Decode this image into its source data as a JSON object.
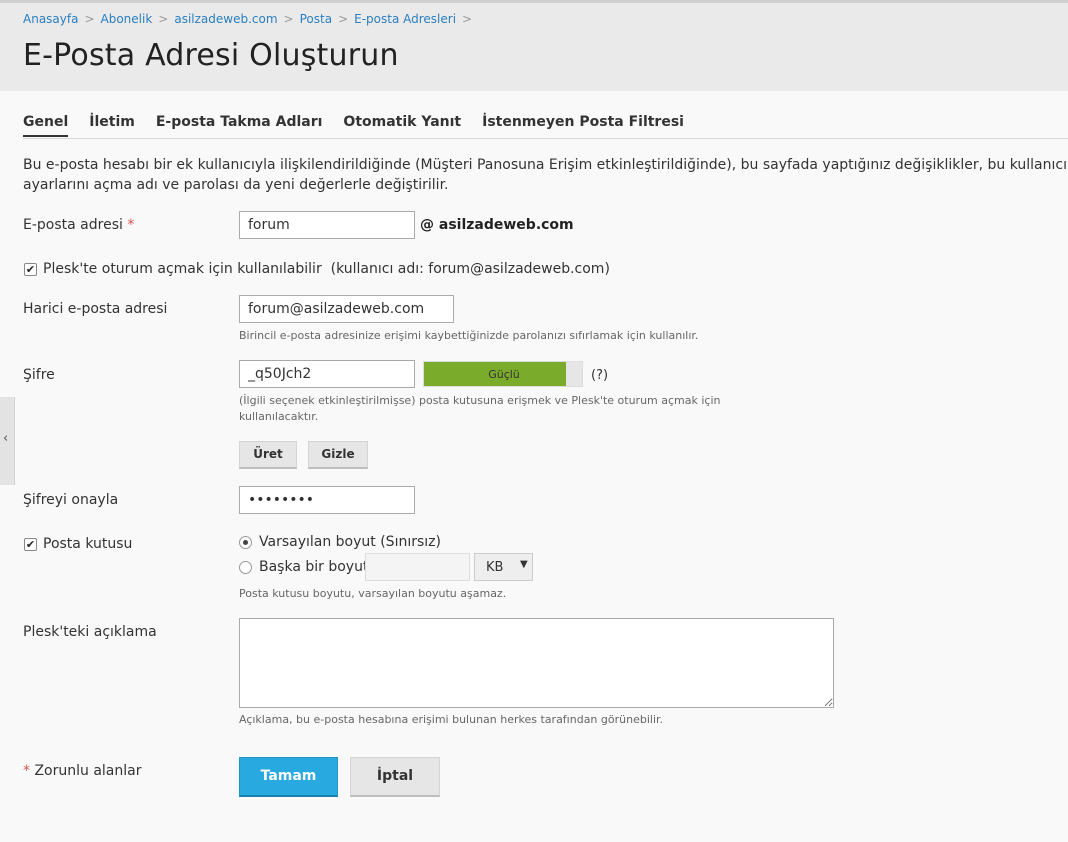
{
  "breadcrumbs": [
    "Anasayfa",
    "Abonelik",
    "asilzadeweb.com",
    "Posta",
    "E-posta Adresleri"
  ],
  "breadcrumb_separator": ">",
  "page_title": "E-Posta Adresi Oluşturun",
  "tabs": [
    {
      "label": "Genel",
      "active": true
    },
    {
      "label": "İletim",
      "active": false
    },
    {
      "label": "E-posta Takma Adları",
      "active": false
    },
    {
      "label": "Otomatik Yanıt",
      "active": false
    },
    {
      "label": "İstenmeyen Posta Filtresi",
      "active": false
    }
  ],
  "intro_text": "Bu e-posta hesabı bir ek kullanıcıyla ilişkilendirildiğinde (Müşteri Panosuna Erişim etkinleştirildiğinde), bu sayfada yaptığınız değişiklikler, bu kullanıcının ayarlarını açma adı ve parolası da yeni değerlerle değiştirilir.",
  "email": {
    "label": "E-posta adresi",
    "required_mark": "*",
    "value": "forum",
    "domain": "@ asilzadeweb.com"
  },
  "plesk_login": {
    "checked": true,
    "label": "Plesk'te oturum açmak için kullanılabilir",
    "username_note": "(kullanıcı adı: forum@asilzadeweb.com)"
  },
  "external_email": {
    "label": "Harici e-posta adresi",
    "value": "forum@asilzadeweb.com",
    "hint": "Birincil e-posta adresinize erişimi kaybettiğinizde parolanızı sıfırlamak için kullanılır."
  },
  "password": {
    "label": "Şifre",
    "value": "_q50Jch2",
    "strength_label": "Güçlü",
    "strength_color": "#7aab2a",
    "strength_level": 0.9,
    "help": "(?)",
    "hint": "(İlgili seçenek etkinleştirilmişse) posta kutusuna erişmek ve Plesk'te oturum açmak için kullanılacaktır.",
    "generate_label": "Üret",
    "hide_label": "Gizle"
  },
  "confirm_password": {
    "label": "Şifreyi onayla",
    "value": "••••••••"
  },
  "mailbox": {
    "checked": true,
    "label": "Posta kutusu",
    "option_default": "Varsayılan boyut (Sınırsız)",
    "option_custom": "Başka bir boyut",
    "selected": "default",
    "size_value": "",
    "unit": "KB",
    "unit_caret": "▼",
    "hint": "Posta kutusu boyutu, varsayılan boyutu aşamaz."
  },
  "description": {
    "label": "Plesk'teki açıklama",
    "value": "",
    "hint": "Açıklama, bu e-posta hesabına erişimi bulunan herkes tarafından görünebilir."
  },
  "footer": {
    "required_mark": "*",
    "required_note": "Zorunlu alanlar",
    "ok_label": "Tamam",
    "cancel_label": "İptal"
  },
  "colors": {
    "link": "#2a7fc1",
    "primary_button": "#28a9e0",
    "strength_bar": "#7aab2a"
  },
  "icons": {
    "sidebar_toggle": "chevron-left-icon",
    "checkbox": "checkmark-icon"
  }
}
